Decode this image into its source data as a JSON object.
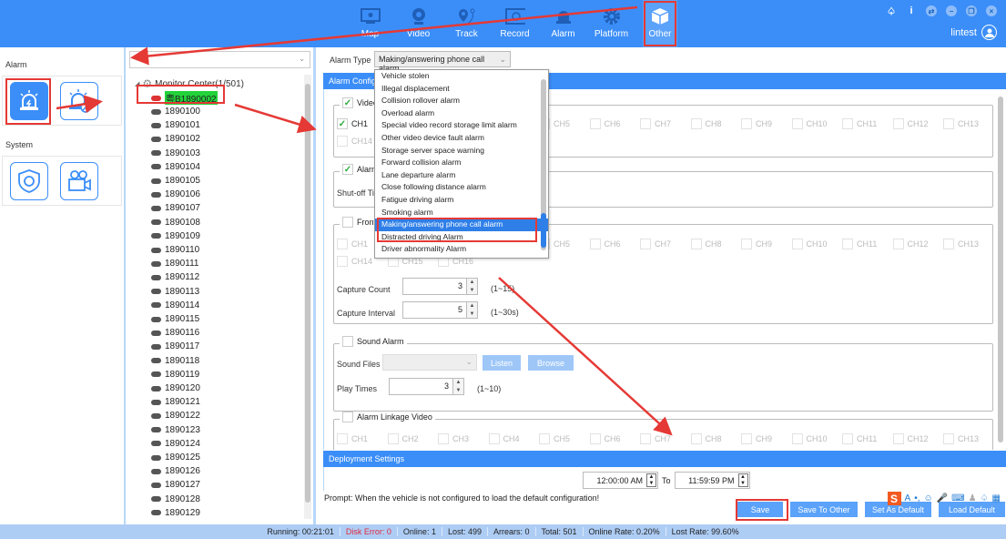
{
  "header": {
    "nav": [
      {
        "label": "Map",
        "icon": "monitor-eye-icon"
      },
      {
        "label": "Video",
        "icon": "webcam-icon"
      },
      {
        "label": "Track",
        "icon": "route-pin-icon"
      },
      {
        "label": "Record",
        "icon": "film-icon"
      },
      {
        "label": "Alarm",
        "icon": "siren-icon"
      },
      {
        "label": "Platform",
        "icon": "gear-icon"
      },
      {
        "label": "Other",
        "icon": "box-icon",
        "active": true
      }
    ],
    "username": "lintest",
    "window_controls": [
      "skin-icon",
      "info-icon",
      "switch-icon",
      "minimize-icon",
      "restore-icon",
      "close-icon"
    ]
  },
  "left_panel": {
    "sections": [
      {
        "title": "Alarm",
        "items": [
          {
            "name": "alarm-config",
            "active": true
          },
          {
            "name": "alarm-disable"
          }
        ]
      },
      {
        "title": "System",
        "items": [
          {
            "name": "system-maintenance"
          },
          {
            "name": "video-settings"
          }
        ]
      }
    ]
  },
  "tree": {
    "search_value": "",
    "root_label": "Monitor Center(1/501)",
    "selected_node": "粤B1890002",
    "nodes": [
      "1890100",
      "1890101",
      "1890102",
      "1890103",
      "1890104",
      "1890105",
      "1890106",
      "1890107",
      "1890108",
      "1890109",
      "1890110",
      "1890111",
      "1890112",
      "1890113",
      "1890114",
      "1890115",
      "1890116",
      "1890117",
      "1890118",
      "1890119",
      "1890120",
      "1890121",
      "1890122",
      "1890123",
      "1890124",
      "1890125",
      "1890126",
      "1890127",
      "1890128",
      "1890129"
    ]
  },
  "main": {
    "alarm_type_label": "Alarm Type",
    "alarm_type_value": "Making/answering phone call alarm",
    "alarm_config_title": "Alarm Config",
    "dropdown_options": [
      "Vehicle stolen",
      "Illegal displacement",
      "Collision rollover alarm",
      "Overload alarm",
      "Special video record storage limit alarm",
      "Other video device fault alarm",
      "Storage server space warning",
      "Forward collision alarm",
      "Lane departure alarm",
      "Close following distance alarm",
      "Fatigue driving alarm",
      "Smoking alarm",
      "Making/answering phone call alarm",
      "Distracted driving Alarm",
      "Driver abnormality Alarm"
    ],
    "dropdown_selected_index": 12,
    "video_preview": {
      "label": "Video Pr",
      "checked": true
    },
    "alarm_video": {
      "label": "Alarm vid",
      "checked": true,
      "shutoff_label": "Shut-off Tim"
    },
    "front_end": {
      "label": "Front-en",
      "checked": false,
      "capture_count_label": "Capture Count",
      "capture_count": "3",
      "capture_count_range": "(1~15)",
      "capture_interval_label": "Capture Interval",
      "capture_interval": "5",
      "capture_interval_range": "(1~30s)"
    },
    "sound_alarm": {
      "label": "Sound Alarm",
      "checked": false,
      "sound_files_label": "Sound Files",
      "listen_label": "Listen",
      "browse_label": "Browse",
      "play_times_label": "Play Times",
      "play_times": "3",
      "play_times_range": "(1~10)"
    },
    "alarm_linkage": {
      "label": "Alarm Linkage Video",
      "checked": false
    },
    "channels": [
      "CH1",
      "CH2",
      "CH3",
      "CH4",
      "CH5",
      "CH6",
      "CH7",
      "CH8",
      "CH9",
      "CH10",
      "CH11",
      "CH12",
      "CH13",
      "CH14",
      "CH15",
      "CH16"
    ],
    "deployment_title": "Deployment Settings",
    "time_from": "12:00:00 AM",
    "time_to_label": "To",
    "time_to": "11:59:59 PM",
    "prompt": "Prompt:  When the vehicle is not configured to load the default configuration!",
    "buttons": {
      "save": "Save",
      "save_to_other": "Save To Other",
      "set_default": "Set As Default",
      "load_default": "Load Default"
    }
  },
  "statusbar": {
    "running": "Running: 00:21:01",
    "disk_error": "Disk Error: 0",
    "online": "Online: 1",
    "lost": "Lost: 499",
    "arrears": "Arrears: 0",
    "total": "Total: 501",
    "online_rate": "Online Rate: 0.20%",
    "lost_rate": "Lost Rate: 99.60%"
  },
  "colors": {
    "brand": "#3b8ef8",
    "annotation": "#e53935",
    "tree_highlight": "#22d33a",
    "error_text": "#e02a3f"
  }
}
